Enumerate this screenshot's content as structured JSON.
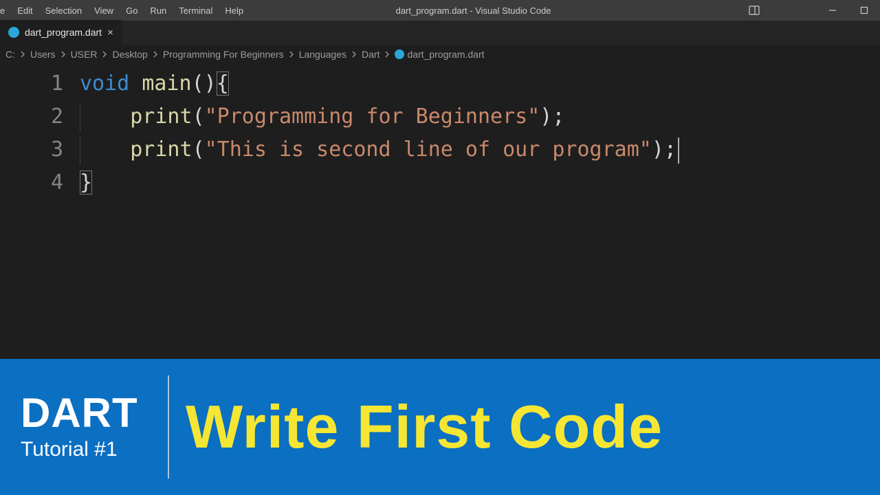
{
  "menu": {
    "items": [
      "e",
      "Edit",
      "Selection",
      "View",
      "Go",
      "Run",
      "Terminal",
      "Help"
    ]
  },
  "window": {
    "title": "dart_program.dart - Visual Studio Code"
  },
  "tab": {
    "filename": "dart_program.dart",
    "close": "×"
  },
  "breadcrumbs": [
    "C:",
    "Users",
    "USER",
    "Desktop",
    "Programming For Beginners",
    "Languages",
    "Dart",
    "dart_program.dart"
  ],
  "code": {
    "line_numbers": [
      "1",
      "2",
      "3",
      "4"
    ],
    "l1": {
      "kw": "void",
      "sp": " ",
      "fn": "main",
      "call": "()",
      "br": "{"
    },
    "l2": {
      "fn": "print",
      "open": "(",
      "str": "\"Programming for Beginners\"",
      "close": ");"
    },
    "l3": {
      "fn": "print",
      "open": "(",
      "str": "\"This is second line of our program\"",
      "close": ");"
    },
    "l4": {
      "br": "}"
    }
  },
  "banner": {
    "brand": "DART",
    "sub": "Tutorial #1",
    "headline": "Write First Code"
  }
}
